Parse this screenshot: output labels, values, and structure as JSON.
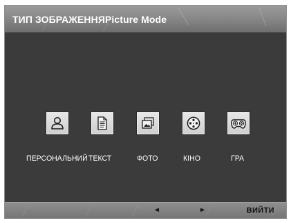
{
  "window": {
    "title": "ТИП ЗОБРАЖЕННЯPicture Mode"
  },
  "modes": [
    {
      "label": "ПЕРСОНАЛЬНИЙ",
      "icon": "person-icon"
    },
    {
      "label": "ТЕКСТ",
      "icon": "document-icon"
    },
    {
      "label": "ФОТО",
      "icon": "photo-icon"
    },
    {
      "label": "КІНО",
      "icon": "film-reel-icon"
    },
    {
      "label": "ГРА",
      "icon": "gamepad-icon"
    }
  ],
  "footer": {
    "left_arrow": "◄",
    "right_arrow": "►",
    "exit_label": "ВИЙТИ"
  },
  "colors": {
    "panel_background": "#3a3a3a",
    "title_bar": "#858585",
    "footer_bar": "#808080",
    "tile_fill": "#dcdcdc"
  }
}
